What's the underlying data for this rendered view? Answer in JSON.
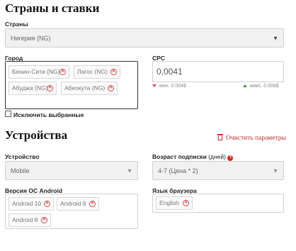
{
  "countries_rates": {
    "title": "Страны и ставки",
    "country": {
      "label": "Страны",
      "value": "Нигерия (NG)"
    },
    "city": {
      "label": "Город",
      "tags": [
        "Бенин-Сити (NG)",
        "Лагос (NG)",
        "Абуджа (NG)",
        "Абеокута (NG)"
      ]
    },
    "cpc": {
      "label": "CPC",
      "value": "0,0041",
      "min_label": "мин. 0.004$",
      "max_label": "макс. 0.008$"
    },
    "exclude_selected": {
      "label": "Исключить выбранные",
      "checked": false
    }
  },
  "devices": {
    "title": "Устройства",
    "clear_label": "Очистить параметры",
    "device": {
      "label": "Устройство",
      "value": "Mobile"
    },
    "subscription_age": {
      "label": "Возраст подписки",
      "label_suffix": "(дней)",
      "value": "4-7 (Цена * 2)"
    },
    "android_version": {
      "label": "Версия ОС Android",
      "tags": [
        "Android 10",
        "Android 9",
        "Android 8"
      ]
    },
    "browser_language": {
      "label": "Язык браузера",
      "tags": [
        "English"
      ]
    }
  },
  "colors": {
    "accent_red": "#c62828",
    "min_down": "#d24a4a",
    "max_up": "#3d9a3d"
  }
}
